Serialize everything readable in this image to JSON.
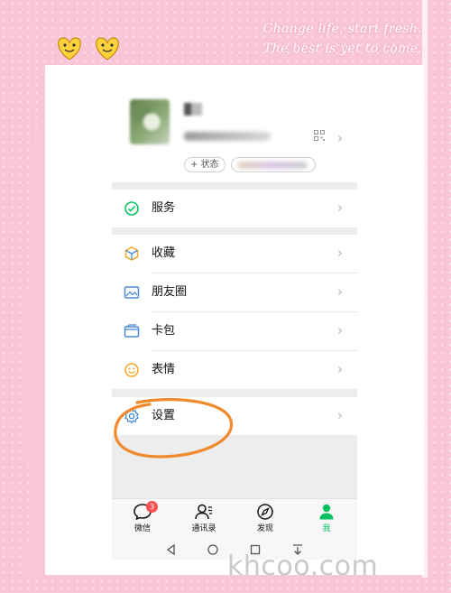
{
  "decoration": {
    "slogan_line1": "Change life, start fresh.",
    "slogan_line2": "The best is yet to come.",
    "watermark": "khcoo.com",
    "frame_color": "#f8c6d6",
    "ring_color": "#f08a2c"
  },
  "profile": {
    "status_label": "+ 状态"
  },
  "menu": {
    "services": "服务",
    "favorites": "收藏",
    "moments": "朋友圈",
    "cards": "卡包",
    "stickers": "表情",
    "settings": "设置"
  },
  "tabbar": {
    "chats": "微信",
    "chats_badge": "3",
    "contacts": "通讯录",
    "discover": "发现",
    "me": "我",
    "active_color": "#07c160"
  },
  "navbar": {
    "back": "◁",
    "home": "○",
    "recents": "□"
  },
  "icons": [
    "services-icon",
    "favorites-icon",
    "moments-icon",
    "cards-icon",
    "stickers-icon",
    "settings-icon",
    "qr-code-icon",
    "chevron-right-icon",
    "chat-icon",
    "contacts-icon",
    "compass-icon",
    "person-icon"
  ]
}
